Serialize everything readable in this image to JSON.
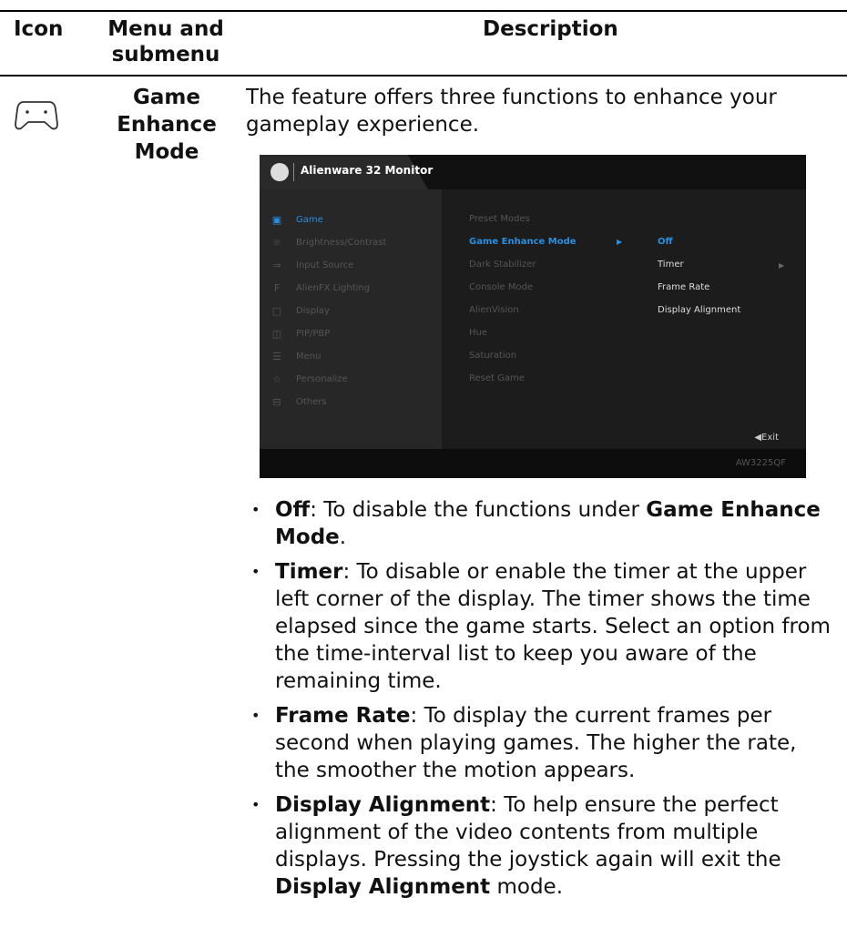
{
  "table_header": {
    "icon": "Icon",
    "menu_line1": "Menu and",
    "menu_line2": "submenu",
    "description": "Description"
  },
  "row": {
    "icon_name": "gamepad-icon",
    "title_line1": "Game Enhance",
    "title_line2": "Mode",
    "intro": "The feature offers three functions to enhance your gameplay experience."
  },
  "osd": {
    "title": "Alienware 32 Monitor",
    "model": "AW3225QF",
    "exit_label": "◀Exit",
    "main_menu": [
      {
        "icon": "gamepad-icon",
        "label": "Game",
        "active": true
      },
      {
        "icon": "brightness-icon",
        "label": "Brightness/Contrast",
        "active": false
      },
      {
        "icon": "input-source-icon",
        "label": "Input Source",
        "active": false
      },
      {
        "icon": "fx-icon",
        "label": "AlienFX Lighting",
        "active": false
      },
      {
        "icon": "display-icon",
        "label": "Display",
        "active": false
      },
      {
        "icon": "pip-icon",
        "label": "PIP/PBP",
        "active": false
      },
      {
        "icon": "menu-icon",
        "label": "Menu",
        "active": false
      },
      {
        "icon": "star-icon",
        "label": "Personalize",
        "active": false
      },
      {
        "icon": "others-icon",
        "label": "Others",
        "active": false
      }
    ],
    "sub_menu": [
      {
        "label": "Preset Modes",
        "active": false
      },
      {
        "label": "Game Enhance Mode",
        "active": true
      },
      {
        "label": "Dark Stabilizer",
        "active": false
      },
      {
        "label": "Console Mode",
        "active": false
      },
      {
        "label": "AlienVision",
        "active": false
      },
      {
        "label": "Hue",
        "active": false
      },
      {
        "label": "Saturation",
        "active": false
      },
      {
        "label": "Reset Game",
        "active": false
      }
    ],
    "options": [
      {
        "label": "Off",
        "selected": true
      },
      {
        "label": "Timer",
        "selected": false,
        "has_submenu": true
      },
      {
        "label": "Frame Rate",
        "selected": false
      },
      {
        "label": "Display Alignment",
        "selected": false
      }
    ],
    "colors": {
      "accent": "#2a8fe0",
      "panel": "#2a2a2a",
      "bar": "#111111"
    }
  },
  "bullets": [
    {
      "term": "Off",
      "text": ": To disable the functions under ",
      "term2": "Game Enhance Mode",
      "tail": "."
    },
    {
      "term": "Timer",
      "text": ": To disable or enable the timer at the upper left corner of the display. The timer shows the time elapsed since the game starts. Select an option from the time-interval list to keep you aware of the remaining time.",
      "term2": "",
      "tail": ""
    },
    {
      "term": "Frame Rate",
      "text": ": To display the current frames per second when playing games. The higher the rate, the smoother the motion appears.",
      "term2": "",
      "tail": ""
    },
    {
      "term": "Display Alignment",
      "text": ": To help ensure the perfect alignment of the video contents from multiple displays. Pressing the joystick again will exit the ",
      "term2": "Display Alignment",
      "tail": " mode."
    }
  ]
}
